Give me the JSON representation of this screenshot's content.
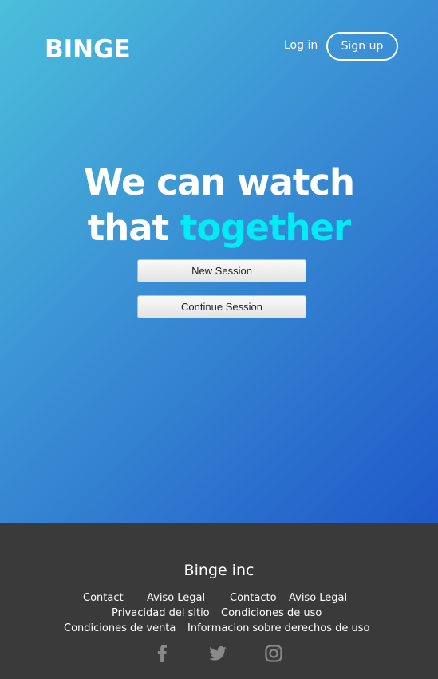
{
  "header": {
    "logo": "BINGE",
    "login_label": "Log in",
    "signup_label": "Sign up"
  },
  "hero": {
    "headline_line1": "We can watch",
    "headline_line2_prefix": "that ",
    "headline_line2_accent": "together",
    "new_session_label": "New Session",
    "continue_session_label": "Continue Session"
  },
  "footer": {
    "title": "Binge inc",
    "links": {
      "contact": "Contact",
      "aviso_legal_1": "Aviso Legal",
      "contacto": "Contacto",
      "aviso_legal_2": "Aviso Legal",
      "privacidad": "Privacidad del sitio",
      "condiciones_uso": "Condiciones de uso",
      "condiciones_venta": "Condiciones de venta",
      "informacion_derechos": "Informacion sobre derechos de uso"
    },
    "social_icons": [
      "facebook-icon",
      "twitter-icon",
      "instagram-icon"
    ]
  },
  "colors": {
    "accent": "#00ecf5",
    "footer_bg": "#3a3a3a",
    "gradient_start": "#4bbfdb",
    "gradient_end": "#1f59c8"
  }
}
